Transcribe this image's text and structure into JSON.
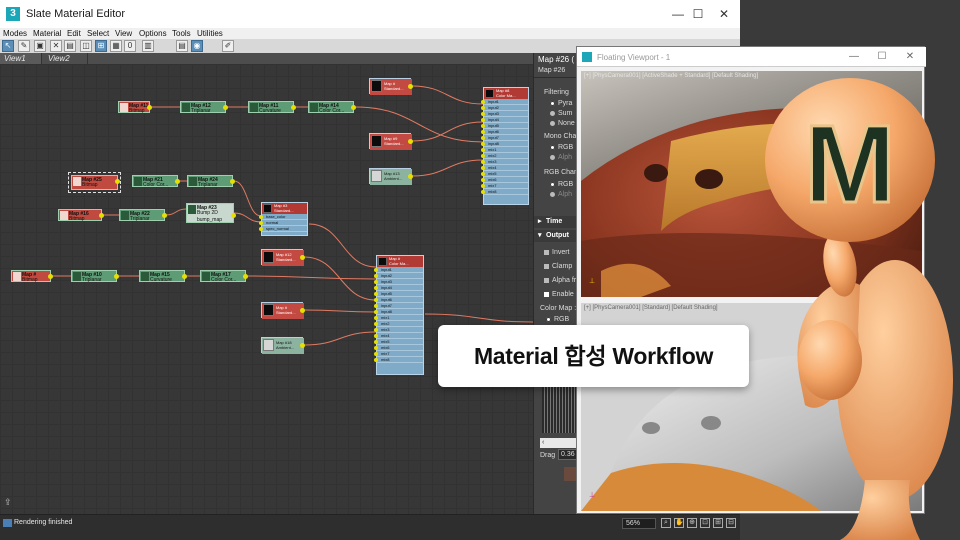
{
  "app": {
    "title": "Slate Material Editor",
    "logo": "3",
    "controls": [
      "—",
      "☐",
      "✕"
    ]
  },
  "menu": [
    "Modes",
    "Material",
    "Edit",
    "Select",
    "View",
    "Options",
    "Tools",
    "Utilities"
  ],
  "toolbar": {
    "icons": [
      "select-arrow-icon",
      "eyedropper-icon",
      "assign-material-icon",
      "delete-icon",
      "move-children-icon",
      "show-map-icon",
      "layout-all-icon",
      "layout-children-icon",
      "hide-unused-icon",
      "show-background-icon",
      "material-map-navigator-icon",
      "parameter-editor-icon",
      "pick-icon"
    ],
    "labels": [
      "↖",
      "✎",
      "▣",
      "✕",
      "▤",
      "◫",
      "⊞",
      "▦",
      "0",
      "▥",
      "▤",
      "◉",
      "✐"
    ]
  },
  "view_tabs": [
    "View1",
    "View2"
  ],
  "nodes": {
    "bitmap_a": {
      "title": "Map #25",
      "sub": "Bitmap"
    },
    "bitmap_b": {
      "title": "Map #11",
      "sub": "Bitmap"
    },
    "bitmap_c": {
      "title": "Map #16",
      "sub": "Bitmap"
    },
    "bitmap_d": {
      "title": "Map #",
      "sub": "Bitmap"
    },
    "tri_12": {
      "title": "Map #12",
      "sub": "Triplanar"
    },
    "curv_11": {
      "title": "Map #11",
      "sub": "Curvature"
    },
    "cc_14": {
      "title": "Map #14",
      "sub": "Color Cor..."
    },
    "cc_21": {
      "title": "Map #21",
      "sub": "Color Cor..."
    },
    "tri_24": {
      "title": "Map #24",
      "sub": "Triplanar"
    },
    "bump_23": {
      "title": "Map #23",
      "sub": "Bump 2D"
    },
    "bump_slot": "bump_map",
    "tri_22": {
      "title": "Map #22",
      "sub": "Triplanar"
    },
    "tri_10": {
      "title": "Map #10",
      "sub": "Triplanar"
    },
    "curv_15": {
      "title": "Map #15",
      "sub": "Curvature"
    },
    "cc_17": {
      "title": "Map #17",
      "sub": "Color Cor..."
    }
  },
  "blend_nodes": {
    "top": {
      "title": "Map #8",
      "sub": "Color Ma..."
    },
    "mid": {
      "title": "Map #3",
      "sub": "Standard..."
    },
    "bottom": {
      "title": "Map #",
      "sub": "Color Ma..."
    }
  },
  "input_slots": [
    "input1",
    "input2",
    "input3",
    "input4",
    "input5",
    "input6",
    "input7",
    "input8",
    "mix1",
    "mix2",
    "mix3",
    "mix4",
    "mix5",
    "mix6",
    "mix7",
    "mix8"
  ],
  "mid_slots": [
    "base_color",
    "normal",
    "spec_normal"
  ],
  "src_nodes": {
    "s1": "Standard...",
    "s2": "Standard...",
    "s3": "Ambient...",
    "s4": "Standard...",
    "s5": "Standard...",
    "s6": "Ambient...",
    "s7": "Ambient..."
  },
  "src_titles": {
    "s1": "Map #",
    "s2": "Map #9",
    "s3": "Map #13",
    "s4": "Map #12",
    "s5": "Map #",
    "s6": "Map #18",
    "s7": "Map #9"
  },
  "param_panel": {
    "title": "Map #26 (",
    "subtitle": "Map #26",
    "filtering": "Filtering",
    "filter_opts": [
      "Pyra",
      "Sum",
      "None"
    ],
    "mono": "Mono Char",
    "mono_opts": [
      "RGB",
      "Alph"
    ],
    "rgb": "RGB Chann",
    "rgb_opts": [
      "RGB",
      "Alph"
    ],
    "time": "Time",
    "output": "Output",
    "output_opts": [
      "Invert",
      "Clamp",
      "Alpha fr",
      "Enable C"
    ],
    "color_map": "Color Map :",
    "color_map_opt": "RGB",
    "drag_label": "Drag",
    "drag_value": "0.36"
  },
  "float_viewport": {
    "title": "Floating Viewport - 1",
    "top_label": "[+] [PhysCamera001] [ActiveShade + Standard] [Default Shading]",
    "bottom_label": "[+] [PhysCamera001] [Standard] [Default Shading]"
  },
  "headline": "Material 합성 Workflow",
  "mascot": {
    "letter": "M"
  },
  "status": {
    "text": "Rendering finished",
    "zoom": "56%",
    "nav_icons": [
      "zoom-icon",
      "pan-icon",
      "zoom-region-icon",
      "frame-selected-icon",
      "frame-all-icon",
      "maximize-icon"
    ],
    "nav_glyphs": [
      "⌕",
      "✋",
      "⊕",
      "⊡",
      "⊞",
      "⊟"
    ]
  },
  "colors": {
    "node_green": "#5d9c74",
    "node_red": "#c04a40",
    "blend_blue": "#7faac8",
    "socket_yellow": "#e6e000",
    "wire": "#e07a62",
    "skin": "#f5a86a"
  }
}
